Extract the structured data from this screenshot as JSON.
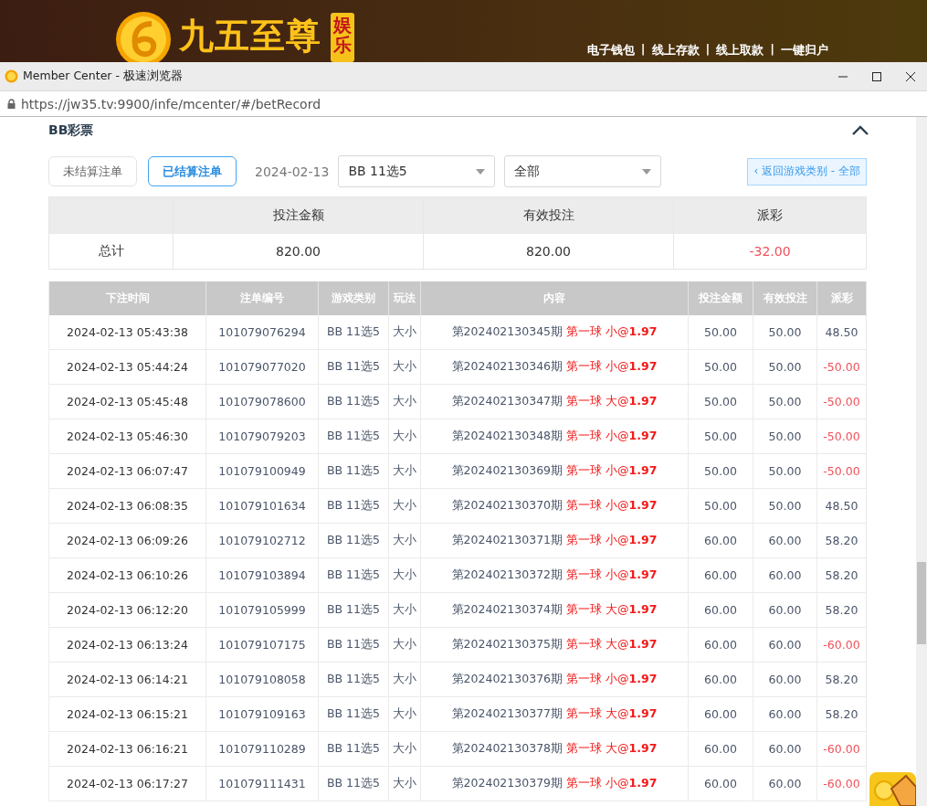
{
  "banner": {
    "brand": "九五至尊",
    "badge": "娱乐",
    "links": [
      "电子钱包",
      "线上存款",
      "线上取款",
      "一键归户"
    ],
    "separator": "|"
  },
  "window": {
    "title": "Member Center - 极速浏览器",
    "url": "https://jw35.tv:9900/infe/mcenter/#/betRecord"
  },
  "section": {
    "title": "BB彩票",
    "expanded": true
  },
  "tabs": [
    {
      "label": "未结算注单",
      "selected": false
    },
    {
      "label": "已结算注单",
      "selected": true
    }
  ],
  "date": "2024-02-13",
  "selects": [
    {
      "value": "BB 11选5"
    },
    {
      "value": "全部"
    }
  ],
  "back_button": "‹ 返回游戏类别 - 全部",
  "summary": {
    "columns": [
      "投注金额",
      "有效投注",
      "派彩"
    ],
    "label": "总计",
    "values": [
      "820.00",
      "820.00",
      "-32.00"
    ],
    "payout_loss": true
  },
  "table": {
    "columns": [
      "下注时间",
      "注单编号",
      "游戏类别",
      "玩法",
      "内容",
      "投注金额",
      "有效投注",
      "派彩"
    ],
    "rows": [
      {
        "time": "2024-02-13 05:43:38",
        "id": "101079076294",
        "game": "BB 11选5",
        "play": "大小",
        "period": "第202402130345期",
        "bet": "第一球 小@**1.97**",
        "amount": "50.00",
        "valid": "50.00",
        "payout": "48.50",
        "loss": false
      },
      {
        "time": "2024-02-13 05:44:24",
        "id": "101079077020",
        "game": "BB 11选5",
        "play": "大小",
        "period": "第202402130346期",
        "bet": "第一球 小@**1.97**",
        "amount": "50.00",
        "valid": "50.00",
        "payout": "-50.00",
        "loss": true
      },
      {
        "time": "2024-02-13 05:45:48",
        "id": "101079078600",
        "game": "BB 11选5",
        "play": "大小",
        "period": "第202402130347期",
        "bet": "第一球 大@**1.97**",
        "amount": "50.00",
        "valid": "50.00",
        "payout": "-50.00",
        "loss": true
      },
      {
        "time": "2024-02-13 05:46:30",
        "id": "101079079203",
        "game": "BB 11选5",
        "play": "大小",
        "period": "第202402130348期",
        "bet": "第一球 小@**1.97**",
        "amount": "50.00",
        "valid": "50.00",
        "payout": "-50.00",
        "loss": true
      },
      {
        "time": "2024-02-13 06:07:47",
        "id": "101079100949",
        "game": "BB 11选5",
        "play": "大小",
        "period": "第202402130369期",
        "bet": "第一球 小@**1.97**",
        "amount": "50.00",
        "valid": "50.00",
        "payout": "-50.00",
        "loss": true
      },
      {
        "time": "2024-02-13 06:08:35",
        "id": "101079101634",
        "game": "BB 11选5",
        "play": "大小",
        "period": "第202402130370期",
        "bet": "第一球 小@**1.97**",
        "amount": "50.00",
        "valid": "50.00",
        "payout": "48.50",
        "loss": false
      },
      {
        "time": "2024-02-13 06:09:26",
        "id": "101079102712",
        "game": "BB 11选5",
        "play": "大小",
        "period": "第202402130371期",
        "bet": "第一球 小@**1.97**",
        "amount": "60.00",
        "valid": "60.00",
        "payout": "58.20",
        "loss": false
      },
      {
        "time": "2024-02-13 06:10:26",
        "id": "101079103894",
        "game": "BB 11选5",
        "play": "大小",
        "period": "第202402130372期",
        "bet": "第一球 小@**1.97**",
        "amount": "60.00",
        "valid": "60.00",
        "payout": "58.20",
        "loss": false
      },
      {
        "time": "2024-02-13 06:12:20",
        "id": "101079105999",
        "game": "BB 11选5",
        "play": "大小",
        "period": "第202402130374期",
        "bet": "第一球 大@**1.97**",
        "amount": "60.00",
        "valid": "60.00",
        "payout": "58.20",
        "loss": false
      },
      {
        "time": "2024-02-13 06:13:24",
        "id": "101079107175",
        "game": "BB 11选5",
        "play": "大小",
        "period": "第202402130375期",
        "bet": "第一球 大@**1.97**",
        "amount": "60.00",
        "valid": "60.00",
        "payout": "-60.00",
        "loss": true
      },
      {
        "time": "2024-02-13 06:14:21",
        "id": "101079108058",
        "game": "BB 11选5",
        "play": "大小",
        "period": "第202402130376期",
        "bet": "第一球 小@**1.97**",
        "amount": "60.00",
        "valid": "60.00",
        "payout": "58.20",
        "loss": false
      },
      {
        "time": "2024-02-13 06:15:21",
        "id": "101079109163",
        "game": "BB 11选5",
        "play": "大小",
        "period": "第202402130377期",
        "bet": "第一球 大@**1.97**",
        "amount": "60.00",
        "valid": "60.00",
        "payout": "58.20",
        "loss": false
      },
      {
        "time": "2024-02-13 06:16:21",
        "id": "101079110289",
        "game": "BB 11选5",
        "play": "大小",
        "period": "第202402130378期",
        "bet": "第一球 大@**1.97**",
        "amount": "60.00",
        "valid": "60.00",
        "payout": "-60.00",
        "loss": true
      },
      {
        "time": "2024-02-13 06:17:27",
        "id": "101079111431",
        "game": "BB 11选5",
        "play": "大小",
        "period": "第202402130379期",
        "bet": "第一球 小@**1.97**",
        "amount": "60.00",
        "valid": "60.00",
        "payout": "-60.00",
        "loss": true
      }
    ]
  }
}
